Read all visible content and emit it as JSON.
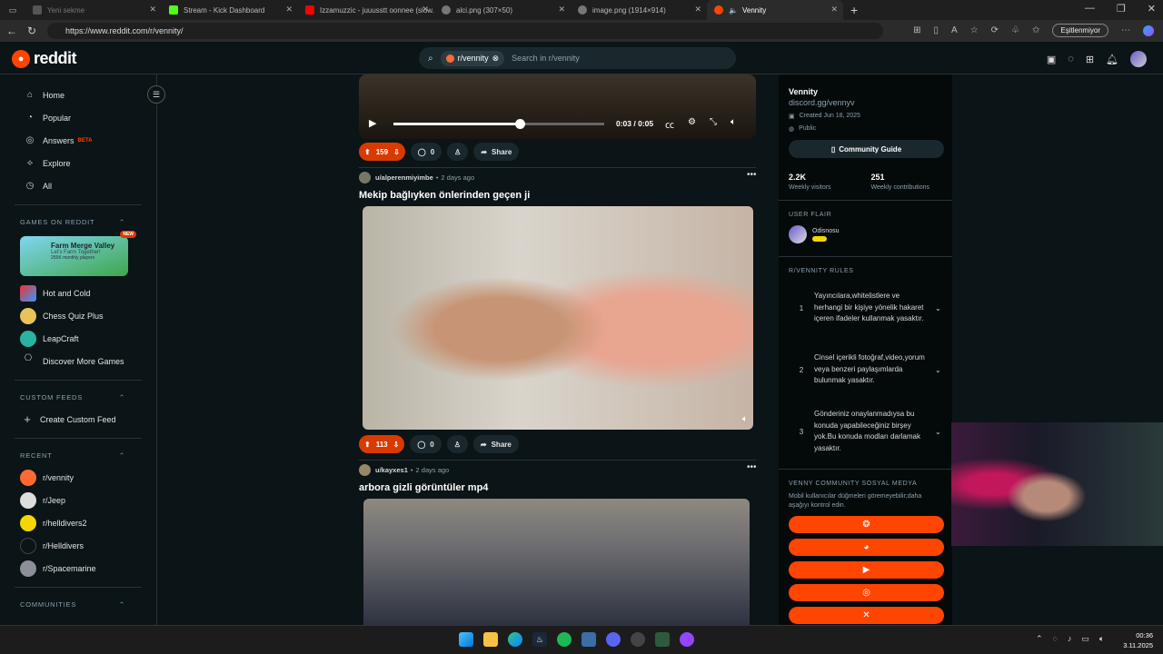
{
  "browser": {
    "tabs": [
      {
        "label": "Yeni sekme",
        "favicon_color": "#555555"
      },
      {
        "label": "Stream - Kick Dashboard",
        "favicon_color": "#53fc18"
      },
      {
        "label": "Izzamuzzic - juuusstt oonnee (slow...",
        "favicon_color": "#ff0000"
      },
      {
        "label": "alci.png (307×50)",
        "favicon_color": "#777777"
      },
      {
        "label": "image.png (1914×914)",
        "favicon_color": "#777777"
      },
      {
        "label": "Vennity",
        "favicon_color": "#ff4500"
      }
    ],
    "url": "https://www.reddit.com/r/vennity/",
    "sync_label": "Eşitlenmiyor"
  },
  "reddit": {
    "logo_text": "reddit",
    "search_chip": "r/vennity",
    "search_placeholder": "Search in r/vennity"
  },
  "left_nav": {
    "items": [
      "Home",
      "Popular",
      "Answers",
      "Explore",
      "All"
    ],
    "beta_label": "BETA",
    "games_header": "GAMES ON REDDIT",
    "featured_game": {
      "title": "Farm Merge Valley",
      "subtitle": "Let's Farm Together!",
      "players": "255K monthly players",
      "badge": "NEW"
    },
    "games": [
      "Hot and Cold",
      "Chess Quiz Plus",
      "LeapCraft",
      "Discover More Games"
    ],
    "custom_feeds_header": "CUSTOM FEEDS",
    "create_custom_feed": "Create Custom Feed",
    "recent_header": "RECENT",
    "recent": [
      "r/vennity",
      "r/Jeep",
      "r/helldivers2",
      "r/Helldivers",
      "r/Spacemarine"
    ],
    "communities_header": "COMMUNITIES"
  },
  "video": {
    "time": "0:03 / 0:05",
    "progress": 0.6
  },
  "posts": [
    {
      "votes": "159",
      "comments": "0",
      "share": "Share"
    },
    {
      "user": "u/alperenmiyimbe",
      "age": "2 days ago",
      "title": "Mekip bağlıyken önlerinden geçen ji",
      "votes": "113",
      "comments": "0",
      "share": "Share"
    },
    {
      "user": "u/kayxes1",
      "age": "2 days ago",
      "title": "arbora gizli görüntüler mp4"
    }
  ],
  "community": {
    "name": "Vennity",
    "link": "discord.gg/vennyv",
    "created": "Created Jun 18, 2025",
    "visibility": "Public",
    "guide_label": "Community Guide",
    "stats": [
      {
        "value": "2.2K",
        "label": "Weekly visitors"
      },
      {
        "value": "251",
        "label": "Weekly contributions"
      }
    ],
    "user_flair_header": "USER FLAIR",
    "flair_name": "Odisnosu",
    "rules_header": "R/VENNITY RULES",
    "rules": [
      {
        "num": "1",
        "text": "Yayıncılara,whitelistlere ve herhangi bir kişiye yönelik hakaret içeren ifadeler kullanmak yasaktır."
      },
      {
        "num": "2",
        "text": "Cinsel içerikli fotoğraf,video,yorum veya benzeri paylaşımlarda bulunmak yasaktır."
      },
      {
        "num": "3",
        "text": "Gönderiniz onaylanmadıysa bu konuda yapabileceğiniz birşey yok.Bu konuda modları darlamak yasaktır."
      }
    ],
    "social_header": "VENNY COMMUNITY SOSYAL MEDYA",
    "social_note": "Mobil kullanıcılar düğmeleri göremeyebilir;daha aşağıyı kontrol edin."
  },
  "taskbar": {
    "time": "00:36",
    "date": "3.11.2025"
  },
  "colors": {
    "accent": "#ff4500",
    "background": "#0b1416"
  }
}
